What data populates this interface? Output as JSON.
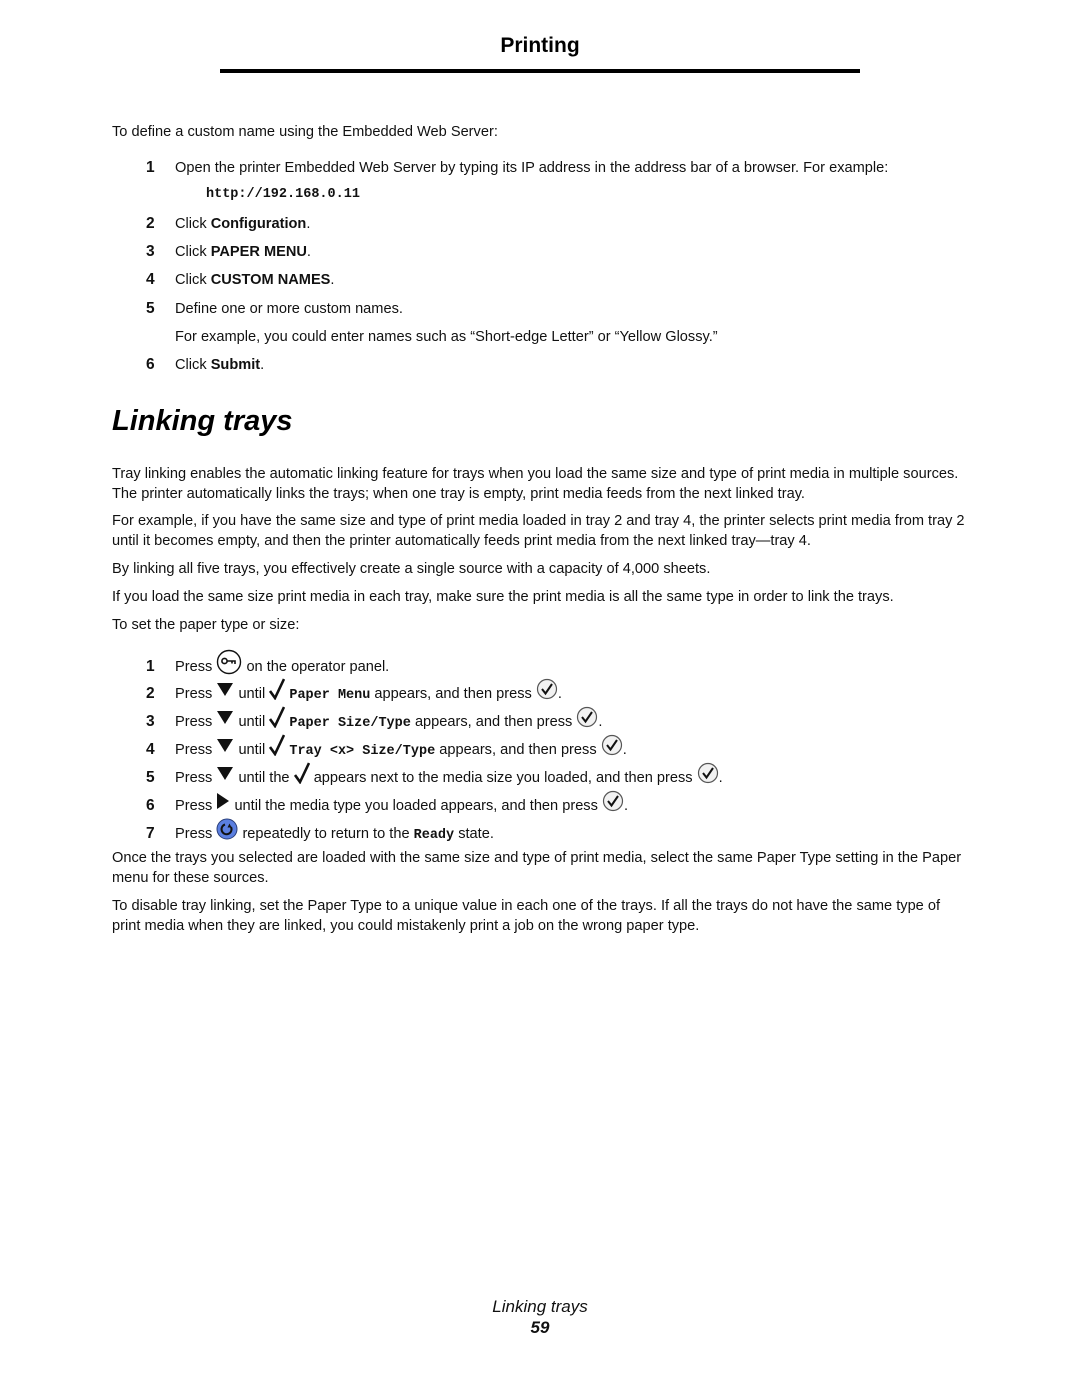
{
  "header": {
    "title": "Printing"
  },
  "custom_names": {
    "intro": "To define a custom name using the Embedded Web Server:",
    "steps": [
      {
        "num": "1",
        "text": "Open the printer Embedded Web Server by typing its IP address in the address bar of a browser. For example:",
        "code": "http://192.168.0.11"
      },
      {
        "num": "2",
        "prefix": "Click ",
        "bold": "Configuration",
        "suffix": "."
      },
      {
        "num": "3",
        "prefix": "Click ",
        "bold": "PAPER MENU",
        "suffix": "."
      },
      {
        "num": "4",
        "prefix": "Click ",
        "bold": "CUSTOM NAMES",
        "suffix": "."
      },
      {
        "num": "5",
        "text": "Define one or more custom names.",
        "note": "For example, you could enter names such as “Short-edge Letter” or “Yellow Glossy.”"
      },
      {
        "num": "6",
        "prefix": "Click ",
        "bold": "Submit",
        "suffix": "."
      }
    ]
  },
  "section": {
    "title": "Linking trays",
    "paragraphs": [
      "Tray linking enables the automatic linking feature for trays when you load the same size and type of print media in multiple sources. The printer automatically links the trays; when one tray is empty, print media feeds from the next linked tray.",
      "For example, if you have the same size and type of print media loaded in tray 2 and tray 4, the printer selects print media from tray 2 until it becomes empty, and then the printer automatically feeds print media from the next linked tray—tray 4.",
      "By linking all five trays, you effectively create a single source with a capacity of 4,000 sheets.",
      "If you load the same size print media in each tray, make sure the print media is all the same type in order to link the trays.",
      "To set the paper type or size:"
    ],
    "steps": [
      {
        "num": "1",
        "press": "Press",
        "icon": "menu-key-icon",
        "after": "on the operator panel."
      },
      {
        "num": "2",
        "press": "Press",
        "icon": "down-arrow-icon",
        "until": "until",
        "mono": "Paper Menu",
        "after": "appears, and then press",
        "end": "."
      },
      {
        "num": "3",
        "press": "Press",
        "icon": "down-arrow-icon",
        "until": "until",
        "mono": "Paper Size/Type",
        "after": "appears, and then press",
        "end": "."
      },
      {
        "num": "4",
        "press": "Press",
        "icon": "down-arrow-icon",
        "until": "until",
        "mono": "Tray <x> Size/Type",
        "after": "appears, and then press",
        "end": "."
      },
      {
        "num": "5",
        "press": "Press",
        "icon": "down-arrow-icon",
        "until": "until the",
        "after": "appears next to the media size you loaded, and then press",
        "end": "."
      },
      {
        "num": "6",
        "press": "Press",
        "icon": "right-arrow-icon",
        "after": "until the media type you loaded appears, and then press",
        "end": "."
      },
      {
        "num": "7",
        "press": "Press",
        "icon": "return-icon",
        "after": "repeatedly to return to the",
        "mono": "Ready",
        "tail": "state."
      }
    ],
    "closing": [
      "Once the trays you selected are loaded with the same size and type of print media, select the same Paper Type setting in the Paper menu for these sources.",
      "To disable tray linking, set the Paper Type to a unique value in each one of the trays. If all the trays do not have the same type of print media when they are linked, you could mistakenly print a job on the wrong paper type."
    ]
  },
  "footer": {
    "title": "Linking trays",
    "page": "59"
  },
  "colors": {
    "return_icon": "#5b7fe0",
    "rule": "#000000"
  }
}
